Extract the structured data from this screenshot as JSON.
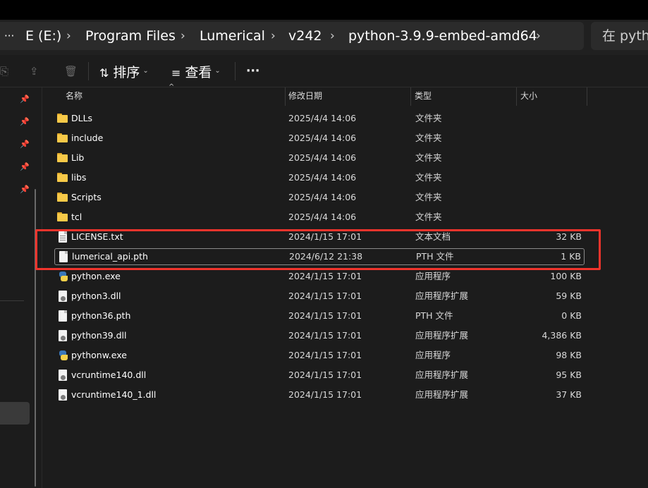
{
  "address": {
    "more": "···",
    "crumbs": [
      "E (E:)",
      "Program Files",
      "Lumerical",
      "v242",
      "python-3.9.9-embed-amd64"
    ],
    "separator": "›",
    "search_placeholder": "在 pyth"
  },
  "toolbar": {
    "sort_label": "排序",
    "view_label": "查看",
    "more": "···"
  },
  "columns": {
    "name": "名称",
    "date": "修改日期",
    "type": "类型",
    "size": "大小"
  },
  "files": [
    {
      "name": "DLLs",
      "date": "2025/4/4 14:06",
      "type": "文件夹",
      "size": "",
      "icon": "folder-icon"
    },
    {
      "name": "include",
      "date": "2025/4/4 14:06",
      "type": "文件夹",
      "size": "",
      "icon": "folder-icon"
    },
    {
      "name": "Lib",
      "date": "2025/4/4 14:06",
      "type": "文件夹",
      "size": "",
      "icon": "folder-icon"
    },
    {
      "name": "libs",
      "date": "2025/4/4 14:06",
      "type": "文件夹",
      "size": "",
      "icon": "folder-icon"
    },
    {
      "name": "Scripts",
      "date": "2025/4/4 14:06",
      "type": "文件夹",
      "size": "",
      "icon": "folder-icon"
    },
    {
      "name": "tcl",
      "date": "2025/4/4 14:06",
      "type": "文件夹",
      "size": "",
      "icon": "folder-icon"
    },
    {
      "name": "LICENSE.txt",
      "date": "2024/1/15 17:01",
      "type": "文本文档",
      "size": "32 KB",
      "icon": "text-file-icon"
    },
    {
      "name": "lumerical_api.pth",
      "date": "2024/6/12 21:38",
      "type": "PTH 文件",
      "size": "1 KB",
      "icon": "file-icon"
    },
    {
      "name": "python.exe",
      "date": "2024/1/15 17:01",
      "type": "应用程序",
      "size": "100 KB",
      "icon": "python-icon"
    },
    {
      "name": "python3.dll",
      "date": "2024/1/15 17:01",
      "type": "应用程序扩展",
      "size": "59 KB",
      "icon": "dll-file-icon"
    },
    {
      "name": "python36.pth",
      "date": "2024/1/15 17:01",
      "type": "PTH 文件",
      "size": "0 KB",
      "icon": "file-icon"
    },
    {
      "name": "python39.dll",
      "date": "2024/1/15 17:01",
      "type": "应用程序扩展",
      "size": "4,386 KB",
      "icon": "dll-file-icon"
    },
    {
      "name": "pythonw.exe",
      "date": "2024/1/15 17:01",
      "type": "应用程序",
      "size": "98 KB",
      "icon": "python-icon"
    },
    {
      "name": "vcruntime140.dll",
      "date": "2024/1/15 17:01",
      "type": "应用程序扩展",
      "size": "95 KB",
      "icon": "dll-file-icon"
    },
    {
      "name": "vcruntime140_1.dll",
      "date": "2024/1/15 17:01",
      "type": "应用程序扩展",
      "size": "37 KB",
      "icon": "dll-file-icon"
    }
  ],
  "highlight_color": "#f0342c"
}
